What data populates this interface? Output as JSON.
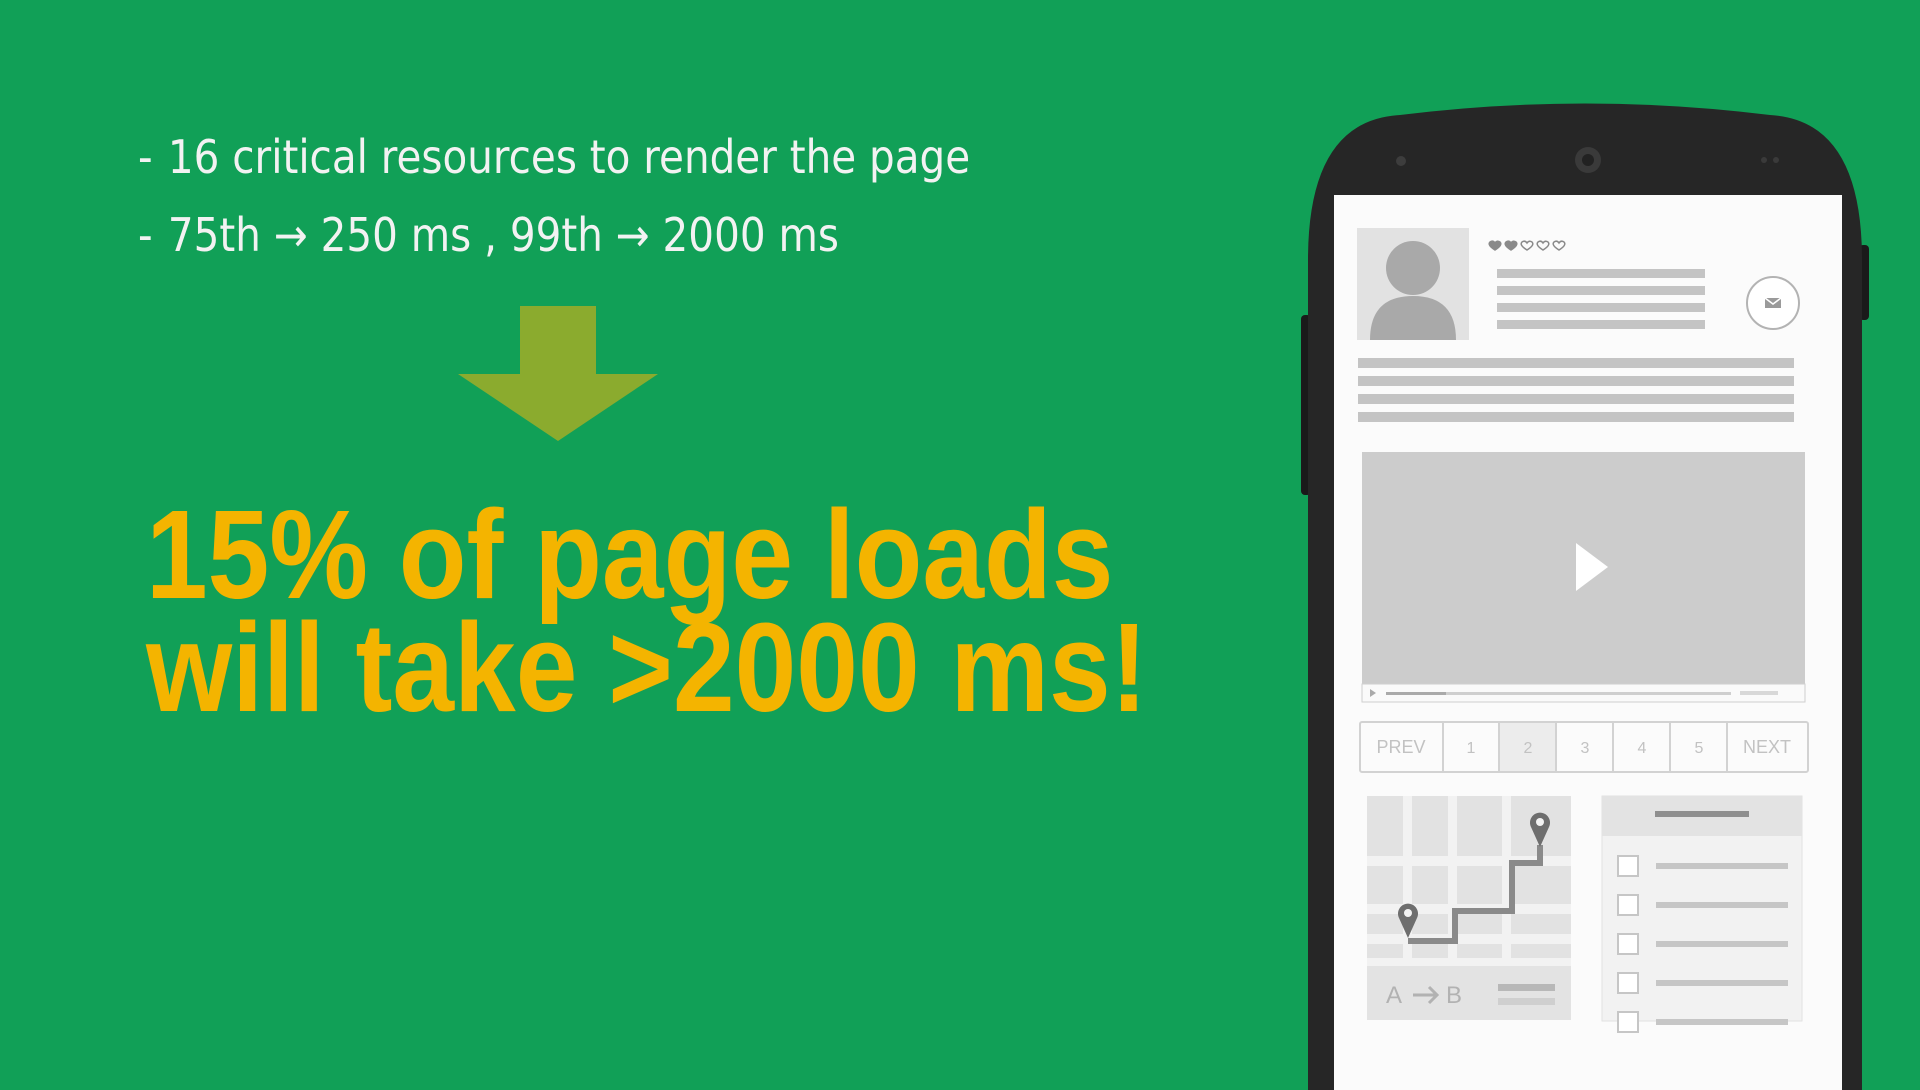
{
  "slide": {
    "bullets": [
      {
        "marker": "-",
        "text": "16 critical resources to render the page"
      },
      {
        "marker": "-",
        "text": "75th → 250 ms , 99th → 2000 ms"
      }
    ],
    "headline": {
      "line1": "15% of page loads",
      "line2": "will take >2000 ms!"
    }
  },
  "phone_mockup": {
    "pagination": {
      "prev": "PREV",
      "pages": [
        "1",
        "2",
        "3",
        "4",
        "5"
      ],
      "next": "NEXT"
    },
    "route": {
      "from": "A",
      "to": "B"
    }
  },
  "colors": {
    "background": "#11a057",
    "headline": "#f4b400",
    "arrow": "#8bab2e",
    "bullet_text": "#f2f2f2"
  },
  "icons": [
    "arrow-down-icon",
    "avatar-icon",
    "heart-icon",
    "mail-icon",
    "play-icon",
    "map-pin-icon",
    "checkbox-icon"
  ]
}
